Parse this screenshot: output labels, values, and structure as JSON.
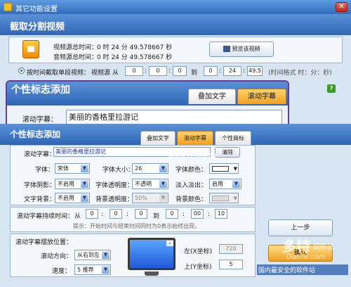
{
  "window": {
    "title": "其它功能设置",
    "close_glyph": "✕"
  },
  "section1": {
    "title": "截取分割视频"
  },
  "video": {
    "src_total_label": "视频源总时间：",
    "audio_total_label": "音频源总时间：",
    "time_value": "0 时 24 分 49.578667 秒",
    "preview_button": "预览该视频"
  },
  "cut": {
    "label": "按时间截取单段视频：",
    "source_label": "视频源",
    "from_label": "从",
    "to_label": "到",
    "from": [
      "0",
      "0",
      "0"
    ],
    "to": [
      "0",
      "24",
      "49.5"
    ],
    "format_hint": "(时间格式 时：分：秒)"
  },
  "callout": {
    "section_title": "个性标志添加",
    "tab_overlay": "叠加文字",
    "tab_scroll": "滚动字幕",
    "scroll_label": "滚动字幕：",
    "scroll_value": "美丽的香格里拉游记"
  },
  "section2": {
    "title": "个性标志添加"
  },
  "tabs": [
    "叠加文字",
    "滚动字幕",
    "个性商标"
  ],
  "form": {
    "scroll_label": "滚动字幕：",
    "scroll_value": "美丽的香格里拉游记",
    "clear_button": "清除",
    "font_label": "字体：",
    "font_value": "宋体",
    "size_label": "字体大小：",
    "size_value": "26",
    "color_label": "字体颜色：",
    "shadow_label": "字体阴影：",
    "shadow_value": "不启用",
    "transp_label": "字体透明度：",
    "transp_value": "不透明",
    "fade_label": "淡入淡出：",
    "fade_value": "启用",
    "bg_label": "文字背景：",
    "bg_value": "不启用",
    "bgtransp_label": "背景透明度：",
    "bgtransp_value": "50%",
    "bgcolor_label": "背景颜色："
  },
  "duration": {
    "label": "滚动字幕持续时间：",
    "from_label": "从",
    "to_label": "到",
    "from": [
      "0",
      "0",
      "0"
    ],
    "to": [
      "0",
      "00",
      "10"
    ],
    "hint": "提示：开始时间与结束时间同时为0表示始终出现。"
  },
  "position": {
    "title": "滚动字幕摆放位置：",
    "direction_label": "滚动方向：",
    "direction_value": "从右到左",
    "speed_label": "速度：",
    "speed_value": "5 推荐",
    "left_label": "左(X坐标)",
    "left_value": "720",
    "top_label": "上(Y坐标)",
    "top_value": "5"
  },
  "buttons": {
    "prev": "上一步",
    "ok": "确认"
  },
  "watermark": {
    "brand": "多特",
    "sub": "软件站",
    "domain": "DuoTe.com",
    "slogan": "国内最安全的软件站"
  },
  "colors": {
    "accent_blue": "#2f66b6",
    "tab_orange": "#f0a020",
    "callout_purple": "#6a3a9a"
  }
}
